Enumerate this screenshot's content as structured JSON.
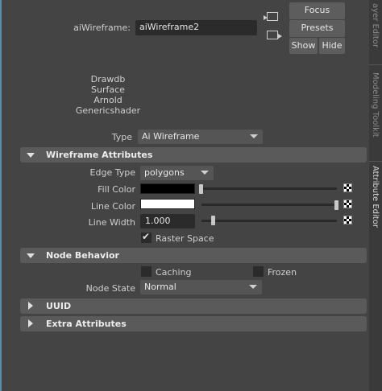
{
  "node": {
    "label": "aiWireframe:",
    "name": "aiWireframe2"
  },
  "buttons": {
    "focus": "Focus",
    "presets": "Presets",
    "show": "Show",
    "hide": "Hide"
  },
  "classifications": [
    "Drawdb",
    "Surface",
    "Arnold",
    "Genericshader"
  ],
  "type_row": {
    "label": "Type",
    "value": "Ai Wireframe"
  },
  "side_tabs": {
    "tab1": "ayer Editor",
    "tab2": "Modeling Toolkit",
    "tab3": "Attribute Editor"
  },
  "wireframe_attributes": {
    "title": "Wireframe Attributes",
    "edge_type": {
      "label": "Edge Type",
      "value": "polygons"
    },
    "fill_color": {
      "label": "Fill Color",
      "color": "#000000",
      "slider": 0.0
    },
    "line_color": {
      "label": "Line Color",
      "color": "#ffffff",
      "slider": 1.0
    },
    "line_width": {
      "label": "Line Width",
      "value": "1.000",
      "slider": 0.09
    },
    "raster_space": {
      "label": "Raster Space",
      "checked": true
    }
  },
  "node_behavior": {
    "title": "Node Behavior",
    "caching": {
      "label": "Caching",
      "checked": false
    },
    "frozen": {
      "label": "Frozen",
      "checked": false
    },
    "node_state": {
      "label": "Node State",
      "value": "Normal"
    }
  },
  "uuid": {
    "title": "UUID"
  },
  "extra_attributes": {
    "title": "Extra Attributes"
  }
}
